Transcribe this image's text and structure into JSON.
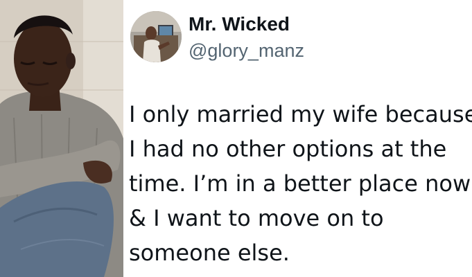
{
  "tweet": {
    "display_name": "Mr. Wicked",
    "handle": "@glory_manz",
    "text_lines": [
      "I only married my wife because",
      "I had no other options at the",
      "time. I’m in a better place now",
      "& I want to move on to",
      "someone else."
    ]
  },
  "colors": {
    "text_primary": "#0f1419",
    "text_secondary": "#536471",
    "background": "#ffffff"
  }
}
